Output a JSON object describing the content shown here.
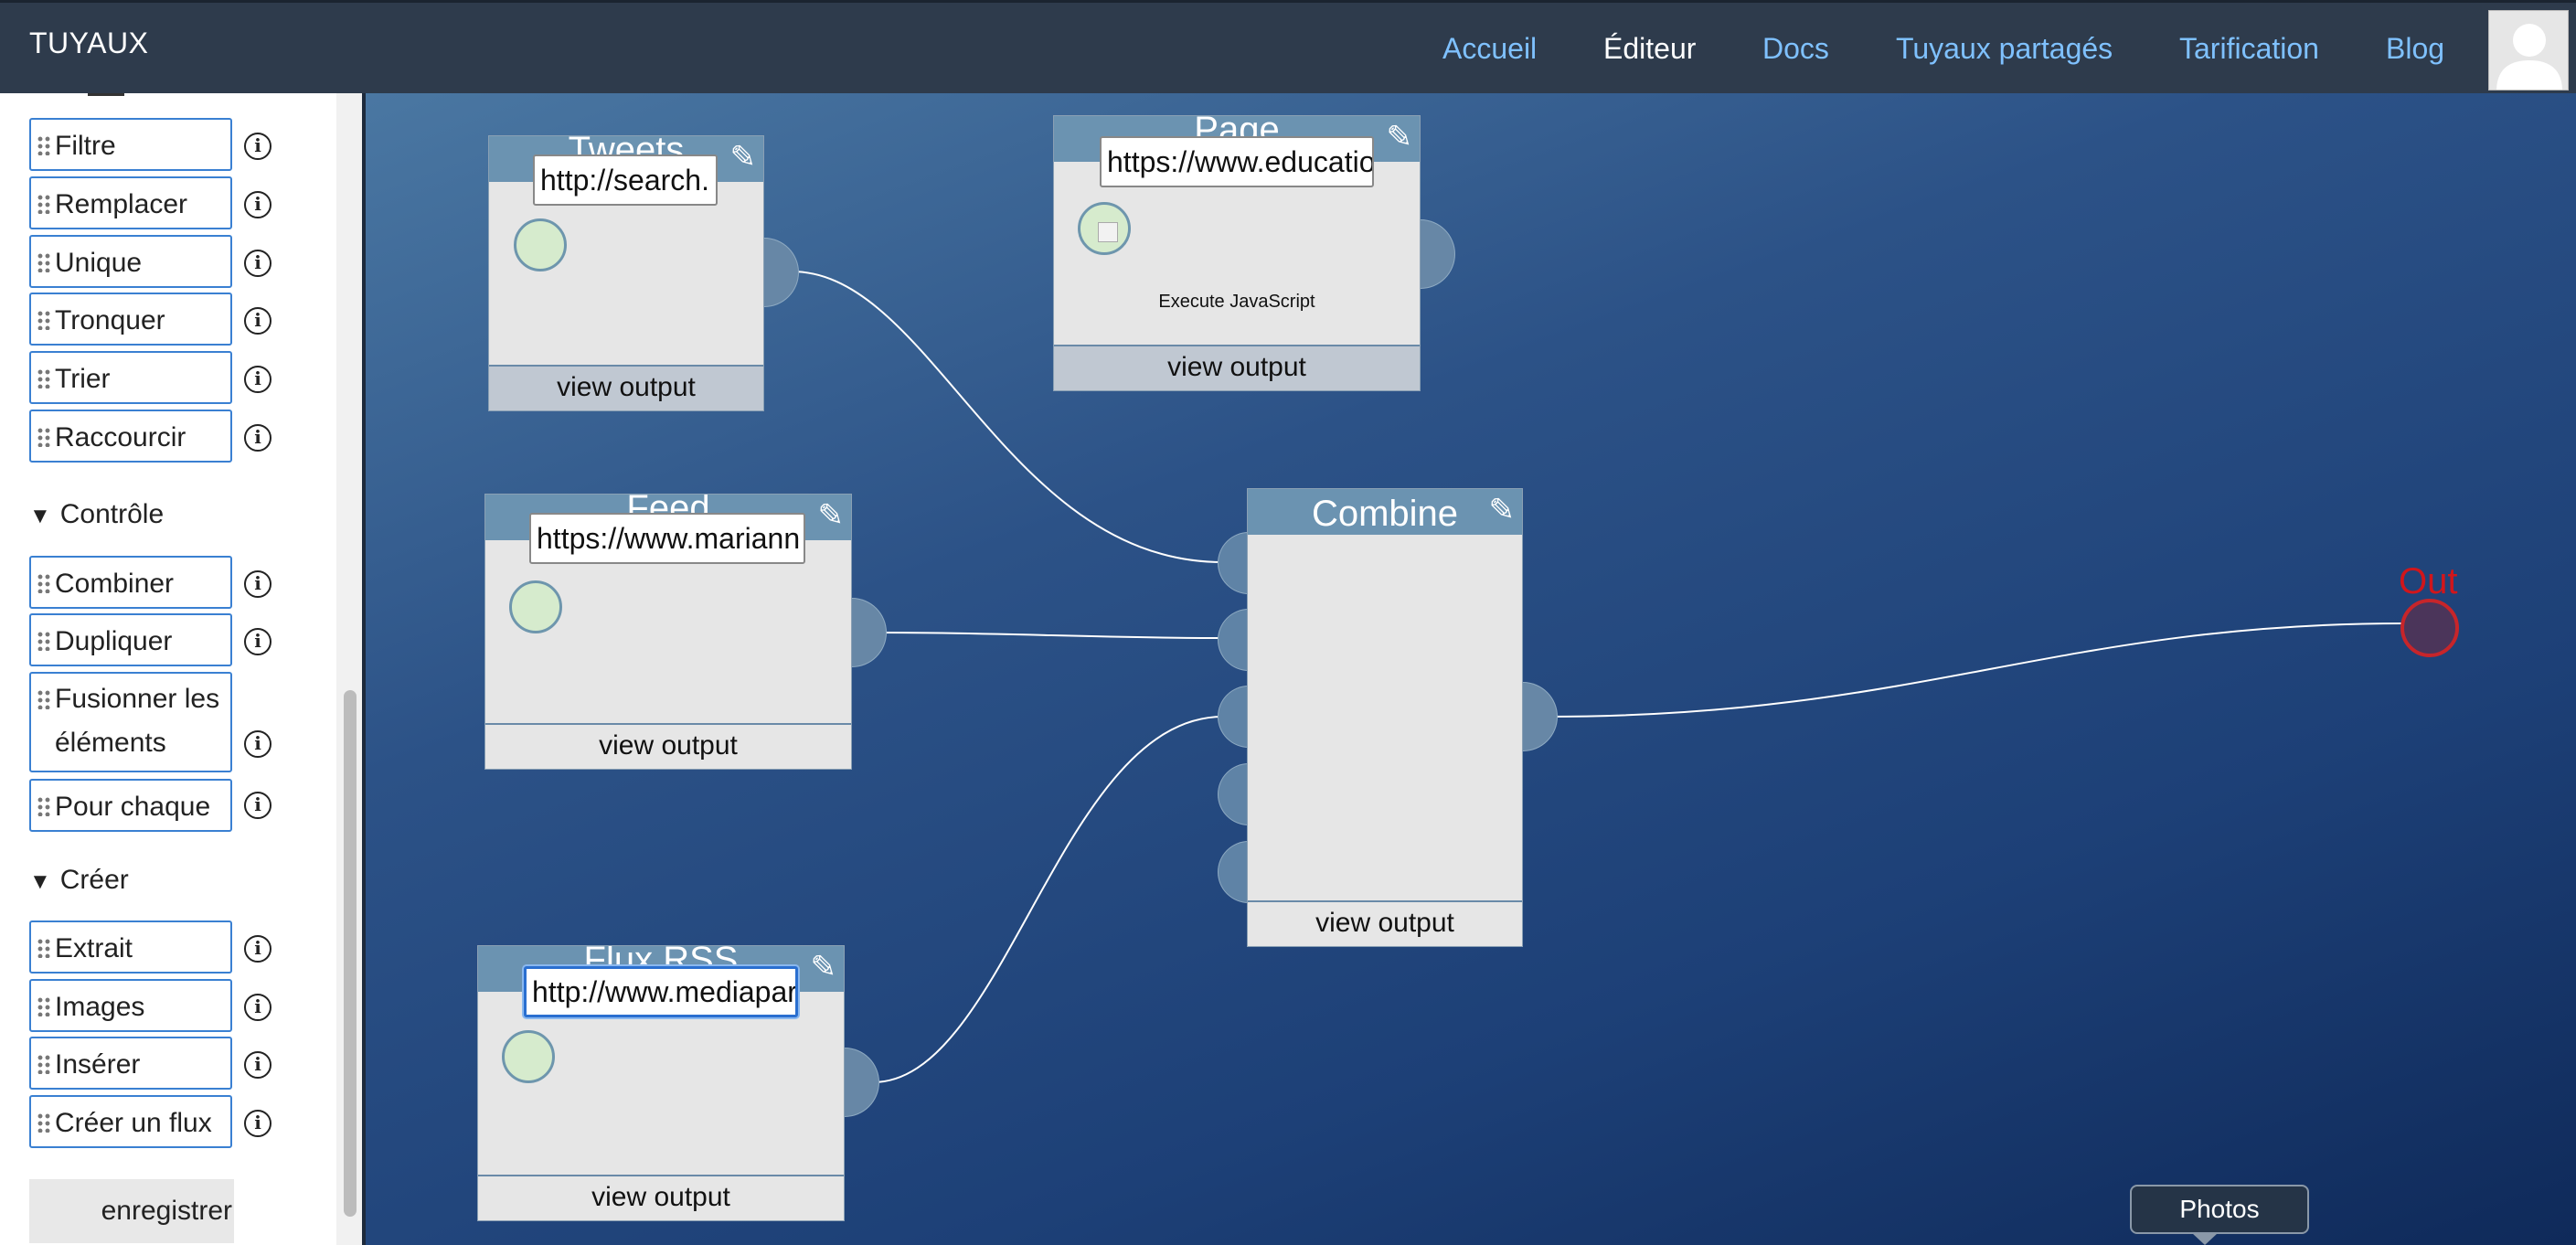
{
  "app": {
    "brand": "TUYAUX"
  },
  "nav": {
    "items": [
      {
        "label": "Accueil",
        "active": false
      },
      {
        "label": "Éditeur",
        "active": true
      },
      {
        "label": "Docs",
        "active": false
      },
      {
        "label": "Tuyaux partagés",
        "active": false
      },
      {
        "label": "Tarification",
        "active": false
      },
      {
        "label": "Blog",
        "active": false
      }
    ],
    "avatar_icon": "user-avatar-icon"
  },
  "sidebar": {
    "group1": [
      "Filtre",
      "Remplacer",
      "Unique",
      "Tronquer",
      "Trier",
      "Raccourcir"
    ],
    "controle_title": "Contrôle",
    "controle": [
      "Combiner",
      "Dupliquer",
      "Fusionner les éléments",
      "Pour chaque"
    ],
    "creer_title": "Créer",
    "creer": [
      "Extrait",
      "Images",
      "Insérer",
      "Créer un flux"
    ],
    "info_glyph": "i",
    "save_label": "enregistrer"
  },
  "canvas": {
    "view_output": "view output",
    "nodes": {
      "tweets": {
        "title": "Tweets",
        "url": "http://search."
      },
      "feed": {
        "title": "Feed",
        "url": "https://www.mariann"
      },
      "flux": {
        "title": "Flux RSS",
        "url": "http://www.mediapar"
      },
      "page": {
        "title": "Page",
        "url": "https://www.educatio",
        "note": "Execute JavaScript"
      },
      "combine": {
        "title": "Combine"
      }
    },
    "out_label": "Out",
    "tooltip": "Photos",
    "colors": {
      "canvas_top": "#4a77a2",
      "canvas_bottom": "#0f2a5a",
      "out": "#d1161b",
      "link": "#7fc1ff"
    }
  }
}
